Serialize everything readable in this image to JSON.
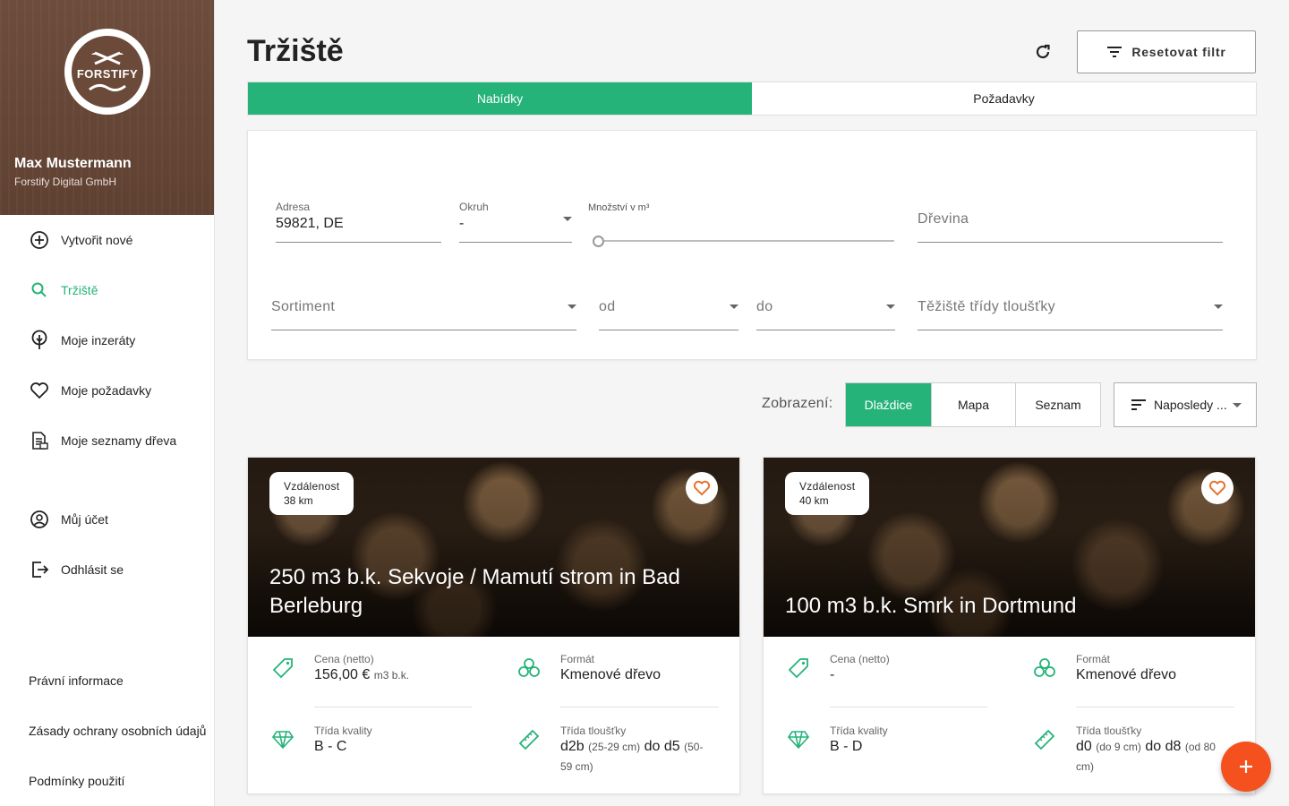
{
  "brand": {
    "logo_text": "FORSTIFY"
  },
  "user": {
    "name": "Max Mustermann",
    "company": "Forstify Digital GmbH"
  },
  "nav": {
    "primary": [
      {
        "label": "Vytvořit nové",
        "icon": "plus-circle-icon"
      },
      {
        "label": "Tržiště",
        "icon": "search-icon",
        "active": true
      },
      {
        "label": "Moje inzeráty",
        "icon": "tree-icon"
      },
      {
        "label": "Moje požadavky",
        "icon": "heart-icon"
      },
      {
        "label": "Moje seznamy dřeva",
        "icon": "document-list-icon"
      }
    ],
    "secondary": [
      {
        "label": "Můj účet",
        "icon": "account-icon"
      },
      {
        "label": "Odhlásit se",
        "icon": "logout-icon"
      }
    ],
    "legal": [
      {
        "label": "Právní informace"
      },
      {
        "label": "Zásady ochrany osobních údajů"
      },
      {
        "label": "Podmínky použití"
      }
    ]
  },
  "header": {
    "title": "Tržiště",
    "reset_label": "Resetovat filtr"
  },
  "tabs": [
    {
      "label": "Nabídky",
      "active": true
    },
    {
      "label": "Požadavky",
      "active": false
    }
  ],
  "filters": {
    "address": {
      "label": "Adresa",
      "value": "59821, DE"
    },
    "radius": {
      "label": "Okruh",
      "value": "-"
    },
    "quantity": {
      "label": "Množství v m³",
      "value": 0
    },
    "species": {
      "placeholder": "Dřevina"
    },
    "assortment": {
      "placeholder": "Sortiment"
    },
    "from": {
      "placeholder": "od"
    },
    "to": {
      "placeholder": "do"
    },
    "diameter_class": {
      "placeholder": "Těžiště třídy tloušťky"
    }
  },
  "view": {
    "label": "Zobrazení:",
    "options": [
      {
        "label": "Dlaždice",
        "active": true
      },
      {
        "label": "Mapa",
        "active": false
      },
      {
        "label": "Seznam",
        "active": false
      }
    ],
    "sort_label": "Naposledy ..."
  },
  "cards": [
    {
      "distance_label": "Vzdálenost",
      "distance": "38 km",
      "title": "250 m3 b.k. Sekvoje / Mamutí strom in Bad Berleburg",
      "price_label": "Cena (netto)",
      "price": "156,00 €",
      "price_unit": "m3 b.k.",
      "format_label": "Formát",
      "format": "Kmenové dřevo",
      "quality_label": "Třída kvality",
      "quality": "B - C",
      "diameter_label": "Třída tloušťky",
      "diameter_from": "d2b",
      "diameter_from_range": "(25-29 cm)",
      "diameter_sep": "do",
      "diameter_to": "d5",
      "diameter_to_range_a": "(50-",
      "diameter_to_range_b": "59 cm)"
    },
    {
      "distance_label": "Vzdálenost",
      "distance": "40 km",
      "title": "100 m3 b.k. Smrk in Dortmund",
      "price_label": "Cena (netto)",
      "price": "-",
      "price_unit": "",
      "format_label": "Formát",
      "format": "Kmenové dřevo",
      "quality_label": "Třída kvality",
      "quality": "B - D",
      "diameter_label": "Třída tloušťky",
      "diameter_from": "d0",
      "diameter_from_range": "(do 9 cm)",
      "diameter_sep": "do",
      "diameter_to": "d8",
      "diameter_to_range_a": "(od 80",
      "diameter_to_range_b": "cm)"
    }
  ],
  "colors": {
    "accent": "#25b37a",
    "sidebar_header": "#6b4a3a",
    "fab": "#f4511e",
    "favorite": "#e8742c"
  }
}
